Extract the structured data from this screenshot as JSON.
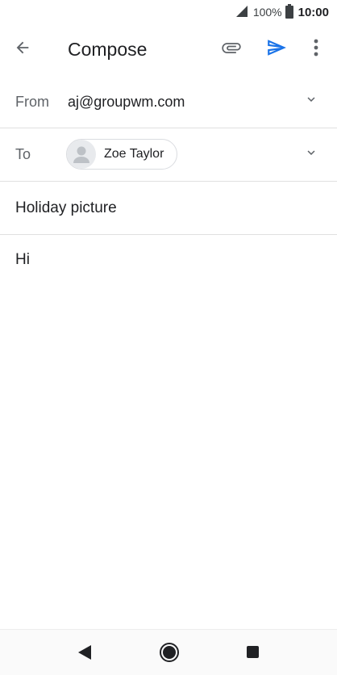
{
  "status_bar": {
    "battery_percent": "100%",
    "time": "10:00"
  },
  "app_bar": {
    "title": "Compose",
    "icons": {
      "back": "arrow-back-icon",
      "attach": "paperclip-icon",
      "send": "send-icon",
      "more": "more-vert-icon"
    }
  },
  "compose": {
    "from_label": "From",
    "from_value": "aj@groupwm.com",
    "to_label": "To",
    "to_recipient": "Zoe Taylor",
    "subject": "Holiday picture",
    "body": "Hi"
  },
  "colors": {
    "accent": "#1a73e8",
    "text_primary": "#202124",
    "text_secondary": "#5f6368",
    "divider": "#e0e0e0"
  }
}
